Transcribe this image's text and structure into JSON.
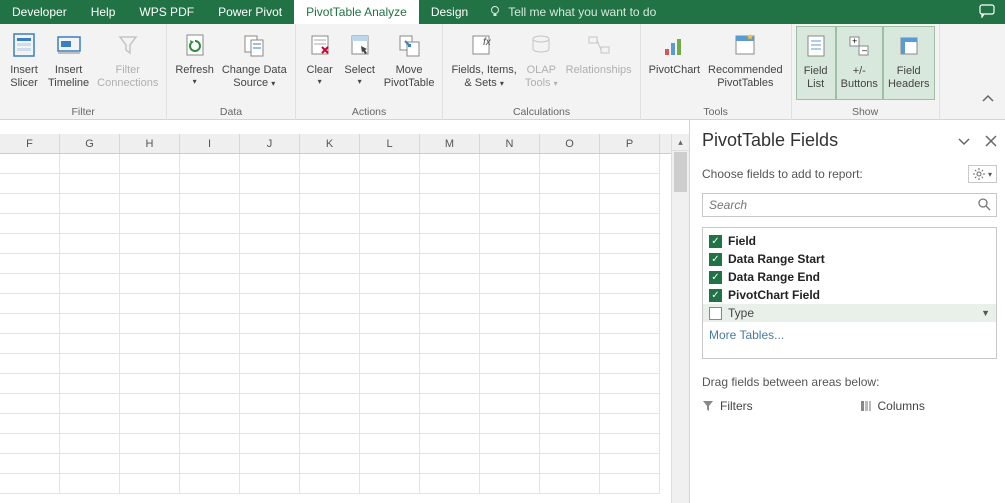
{
  "titlebar": {
    "tabs": [
      "Developer",
      "Help",
      "WPS PDF",
      "Power Pivot",
      "PivotTable Analyze",
      "Design"
    ],
    "active_index": 4,
    "tell_me": "Tell me what you want to do"
  },
  "ribbon": {
    "groups": [
      {
        "label": "Filter",
        "buttons": [
          {
            "id": "insert-slicer",
            "line1": "Insert",
            "line2": "Slicer",
            "disabled": false
          },
          {
            "id": "insert-timeline",
            "line1": "Insert",
            "line2": "Timeline",
            "disabled": false
          },
          {
            "id": "filter-connections",
            "line1": "Filter",
            "line2": "Connections",
            "disabled": true
          }
        ]
      },
      {
        "label": "Data",
        "buttons": [
          {
            "id": "refresh",
            "line1": "Refresh",
            "line2": "",
            "dd": true
          },
          {
            "id": "change-data-source",
            "line1": "Change Data",
            "line2": "Source",
            "dd": true
          }
        ]
      },
      {
        "label": "Actions",
        "buttons": [
          {
            "id": "clear",
            "line1": "Clear",
            "line2": "",
            "dd": true
          },
          {
            "id": "select",
            "line1": "Select",
            "line2": "",
            "dd": true
          },
          {
            "id": "move-pivottable",
            "line1": "Move",
            "line2": "PivotTable"
          }
        ]
      },
      {
        "label": "Calculations",
        "buttons": [
          {
            "id": "fields-items-sets",
            "line1": "Fields, Items,",
            "line2": "& Sets",
            "dd": true
          },
          {
            "id": "olap-tools",
            "line1": "OLAP",
            "line2": "Tools",
            "dd": true,
            "disabled": true
          },
          {
            "id": "relationships",
            "line1": "Relationships",
            "line2": "",
            "disabled": true
          }
        ]
      },
      {
        "label": "Tools",
        "buttons": [
          {
            "id": "pivotchart",
            "line1": "PivotChart",
            "line2": ""
          },
          {
            "id": "recommended-pivottables",
            "line1": "Recommended",
            "line2": "PivotTables"
          }
        ]
      },
      {
        "label": "Show",
        "buttons": [
          {
            "id": "field-list",
            "line1": "Field",
            "line2": "List",
            "toggled": true
          },
          {
            "id": "buttons-toggle",
            "line1": "+/-",
            "line2": "Buttons",
            "toggled": true
          },
          {
            "id": "field-headers",
            "line1": "Field",
            "line2": "Headers",
            "toggled": true
          }
        ]
      }
    ]
  },
  "grid": {
    "columns": [
      "F",
      "G",
      "H",
      "I",
      "J",
      "K",
      "L",
      "M",
      "N",
      "O",
      "P"
    ],
    "rows": 17
  },
  "pane": {
    "title": "PivotTable Fields",
    "subtitle": "Choose fields to add to report:",
    "search_placeholder": "Search",
    "fields": [
      {
        "label": "Field",
        "checked": true,
        "bold": true
      },
      {
        "label": "Data Range Start",
        "checked": true,
        "bold": true
      },
      {
        "label": "Data Range End",
        "checked": true,
        "bold": true
      },
      {
        "label": "PivotChart Field",
        "checked": true,
        "bold": true
      },
      {
        "label": "Type",
        "checked": false,
        "bold": false,
        "highlight": true,
        "dropdown": true
      }
    ],
    "more_tables": "More Tables...",
    "drag_label": "Drag fields between areas below:",
    "areas": [
      {
        "icon": "filter",
        "label": "Filters"
      },
      {
        "icon": "columns",
        "label": "Columns"
      }
    ]
  }
}
